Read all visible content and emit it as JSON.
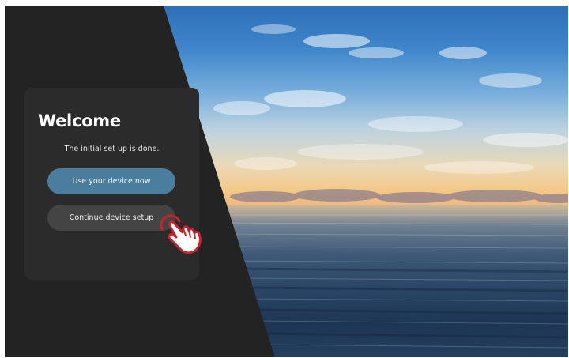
{
  "welcome_card": {
    "title": "Welcome",
    "subtitle": "The initial set up is done.",
    "primary_button_label": "Use your device now",
    "secondary_button_label": "Continue device setup"
  },
  "icons": {
    "pointer": "hand-pointer-icon"
  },
  "colors": {
    "panel_background": "#232323",
    "card_background": "#2b2b2b",
    "primary_button": "#4b7e9e",
    "secondary_button": "#444444",
    "hand_accent": "#c8232c"
  }
}
